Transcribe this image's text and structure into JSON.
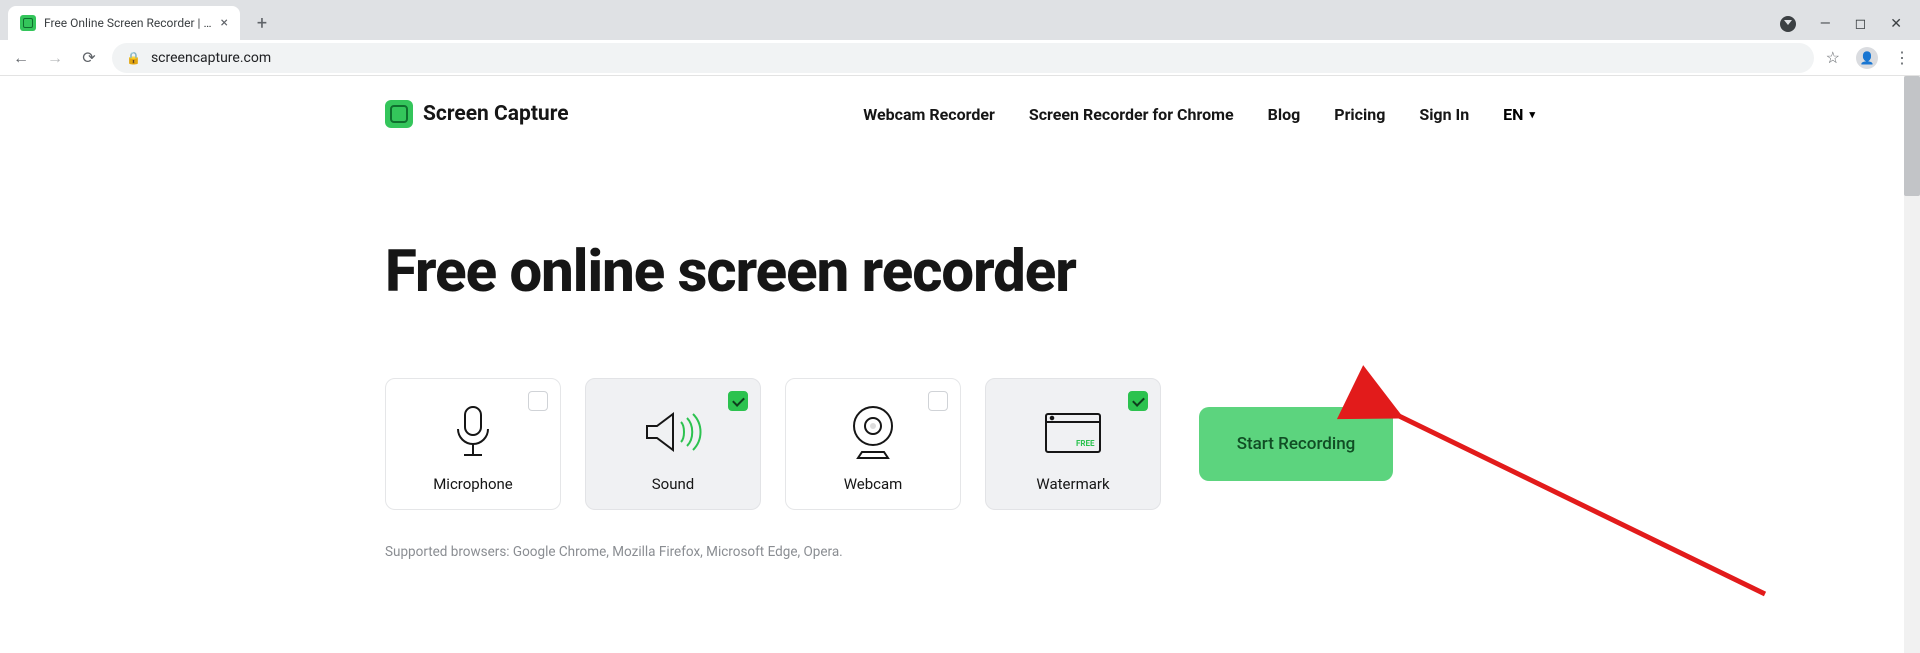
{
  "browser": {
    "tab_title": "Free Online Screen Recorder | Fre",
    "url": "screencapture.com"
  },
  "header": {
    "brand": "Screen Capture",
    "nav": {
      "webcam": "Webcam Recorder",
      "chrome": "Screen Recorder for Chrome",
      "blog": "Blog",
      "pricing": "Pricing",
      "signin": "Sign In",
      "lang": "EN"
    }
  },
  "hero": {
    "title": "Free online screen recorder"
  },
  "options": {
    "microphone": {
      "label": "Microphone",
      "checked": false
    },
    "sound": {
      "label": "Sound",
      "checked": true
    },
    "webcam": {
      "label": "Webcam",
      "checked": false
    },
    "watermark": {
      "label": "Watermark",
      "checked": true
    }
  },
  "cta": {
    "start": "Start Recording"
  },
  "footer": {
    "supported": "Supported browsers: Google Chrome, Mozilla Firefox, Microsoft Edge, Opera."
  }
}
